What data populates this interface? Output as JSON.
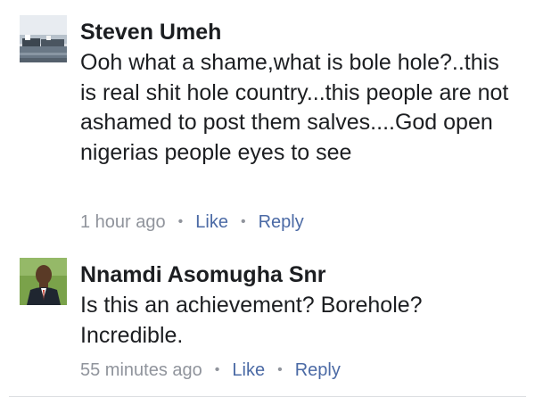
{
  "comments": [
    {
      "author": "Steven Umeh",
      "text": "Ooh what a shame,what is bole hole?..this is real shit hole country...this people are not ashamed to post them salves....God open nigerias people eyes to see",
      "time": "1 hour ago",
      "like_label": "Like",
      "reply_label": "Reply",
      "separator": "•"
    },
    {
      "author": "Nnamdi Asomugha Snr",
      "text": "Is this an achievement? Borehole? Incredible.",
      "time": "55 minutes ago",
      "like_label": "Like",
      "reply_label": "Reply",
      "separator": "•"
    }
  ]
}
